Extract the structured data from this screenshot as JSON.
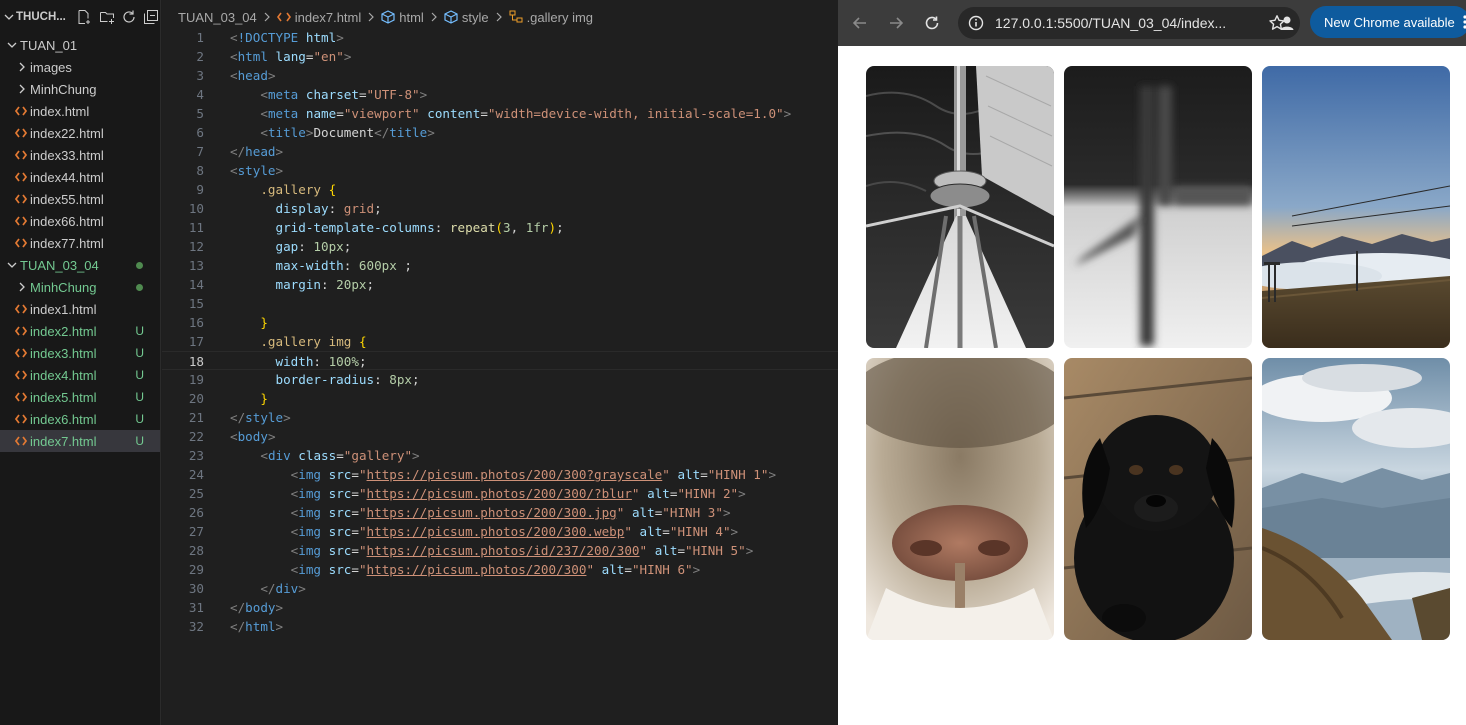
{
  "explorer": {
    "title": "THUCH...",
    "items": [
      {
        "label": "TUAN_01",
        "kind": "folder-open",
        "indent": 0,
        "color": "normal"
      },
      {
        "label": "images",
        "kind": "folder",
        "indent": 1,
        "color": "normal"
      },
      {
        "label": "MinhChung",
        "kind": "folder",
        "indent": 1,
        "color": "normal"
      },
      {
        "label": "index.html",
        "kind": "file",
        "indent": 1,
        "color": "normal"
      },
      {
        "label": "index22.html",
        "kind": "file",
        "indent": 1,
        "color": "normal"
      },
      {
        "label": "index33.html",
        "kind": "file",
        "indent": 1,
        "color": "normal"
      },
      {
        "label": "index44.html",
        "kind": "file",
        "indent": 1,
        "color": "normal"
      },
      {
        "label": "index55.html",
        "kind": "file",
        "indent": 1,
        "color": "normal"
      },
      {
        "label": "index66.html",
        "kind": "file",
        "indent": 1,
        "color": "normal"
      },
      {
        "label": "index77.html",
        "kind": "file",
        "indent": 1,
        "color": "normal"
      },
      {
        "label": "TUAN_03_04",
        "kind": "folder-open",
        "indent": 0,
        "color": "green",
        "status": "dot"
      },
      {
        "label": "MinhChung",
        "kind": "folder",
        "indent": 1,
        "color": "green",
        "status": "dot"
      },
      {
        "label": "index1.html",
        "kind": "file",
        "indent": 1,
        "color": "normal"
      },
      {
        "label": "index2.html",
        "kind": "file",
        "indent": 1,
        "color": "green",
        "status": "U"
      },
      {
        "label": "index3.html",
        "kind": "file",
        "indent": 1,
        "color": "green",
        "status": "U"
      },
      {
        "label": "index4.html",
        "kind": "file",
        "indent": 1,
        "color": "green",
        "status": "U"
      },
      {
        "label": "index5.html",
        "kind": "file",
        "indent": 1,
        "color": "green",
        "status": "U"
      },
      {
        "label": "index6.html",
        "kind": "file",
        "indent": 1,
        "color": "green",
        "status": "U"
      },
      {
        "label": "index7.html",
        "kind": "file",
        "indent": 1,
        "color": "green",
        "status": "U",
        "selected": true
      }
    ]
  },
  "breadcrumb": {
    "folder": "TUAN_03_04",
    "file": "index7.html",
    "html": "html",
    "style": "style",
    "selector": ".gallery img"
  },
  "editor": {
    "current_line": 18,
    "lines": [
      [
        [
          "t-bracket",
          "<"
        ],
        [
          "t-tag",
          "!DOCTYPE"
        ],
        [
          "t-text",
          " "
        ],
        [
          "t-attr",
          "html"
        ],
        [
          "t-bracket",
          ">"
        ]
      ],
      [
        [
          "t-bracket",
          "<"
        ],
        [
          "t-tag",
          "html"
        ],
        [
          "t-text",
          " "
        ],
        [
          "t-attr",
          "lang"
        ],
        [
          "t-punct",
          "="
        ],
        [
          "t-str",
          "\"en\""
        ],
        [
          "t-bracket",
          ">"
        ]
      ],
      [
        [
          "t-bracket",
          "<"
        ],
        [
          "t-tag",
          "head"
        ],
        [
          "t-bracket",
          ">"
        ]
      ],
      [
        [
          "t-text",
          "    "
        ],
        [
          "t-bracket",
          "<"
        ],
        [
          "t-tag",
          "meta"
        ],
        [
          "t-text",
          " "
        ],
        [
          "t-attr",
          "charset"
        ],
        [
          "t-punct",
          "="
        ],
        [
          "t-str",
          "\"UTF-8\""
        ],
        [
          "t-bracket",
          ">"
        ]
      ],
      [
        [
          "t-text",
          "    "
        ],
        [
          "t-bracket",
          "<"
        ],
        [
          "t-tag",
          "meta"
        ],
        [
          "t-text",
          " "
        ],
        [
          "t-attr",
          "name"
        ],
        [
          "t-punct",
          "="
        ],
        [
          "t-str",
          "\"viewport\""
        ],
        [
          "t-text",
          " "
        ],
        [
          "t-attr",
          "content"
        ],
        [
          "t-punct",
          "="
        ],
        [
          "t-str",
          "\"width=device-width, initial-scale=1.0\""
        ],
        [
          "t-bracket",
          ">"
        ]
      ],
      [
        [
          "t-text",
          "    "
        ],
        [
          "t-bracket",
          "<"
        ],
        [
          "t-tag",
          "title"
        ],
        [
          "t-bracket",
          ">"
        ],
        [
          "t-text",
          "Document"
        ],
        [
          "t-bracket",
          "</"
        ],
        [
          "t-tag",
          "title"
        ],
        [
          "t-bracket",
          ">"
        ]
      ],
      [
        [
          "t-bracket",
          "</"
        ],
        [
          "t-tag",
          "head"
        ],
        [
          "t-bracket",
          ">"
        ]
      ],
      [
        [
          "t-bracket",
          "<"
        ],
        [
          "t-tag",
          "style"
        ],
        [
          "t-bracket",
          ">"
        ]
      ],
      [
        [
          "t-text",
          "    "
        ],
        [
          "t-sel",
          ".gallery"
        ],
        [
          "t-text",
          " "
        ],
        [
          "t-brace",
          "{"
        ]
      ],
      [
        [
          "t-text",
          "      "
        ],
        [
          "t-prop",
          "display"
        ],
        [
          "t-punct",
          ": "
        ],
        [
          "t-val",
          "grid"
        ],
        [
          "t-punct",
          ";"
        ]
      ],
      [
        [
          "t-text",
          "      "
        ],
        [
          "t-prop",
          "grid-template-columns"
        ],
        [
          "t-punct",
          ": "
        ],
        [
          "t-fn",
          "repeat"
        ],
        [
          "t-brace",
          "("
        ],
        [
          "t-num",
          "3"
        ],
        [
          "t-punct",
          ", "
        ],
        [
          "t-num",
          "1fr"
        ],
        [
          "t-brace",
          ")"
        ],
        [
          "t-punct",
          ";"
        ]
      ],
      [
        [
          "t-text",
          "      "
        ],
        [
          "t-prop",
          "gap"
        ],
        [
          "t-punct",
          ": "
        ],
        [
          "t-num",
          "10px"
        ],
        [
          "t-punct",
          ";"
        ]
      ],
      [
        [
          "t-text",
          "      "
        ],
        [
          "t-prop",
          "max-width"
        ],
        [
          "t-punct",
          ": "
        ],
        [
          "t-num",
          "600px"
        ],
        [
          "t-punct",
          " ;"
        ]
      ],
      [
        [
          "t-text",
          "      "
        ],
        [
          "t-prop",
          "margin"
        ],
        [
          "t-punct",
          ": "
        ],
        [
          "t-num",
          "20px"
        ],
        [
          "t-punct",
          ";"
        ]
      ],
      [
        [
          "t-text",
          ""
        ]
      ],
      [
        [
          "t-text",
          "    "
        ],
        [
          "t-brace",
          "}"
        ]
      ],
      [
        [
          "t-text",
          "    "
        ],
        [
          "t-sel",
          ".gallery"
        ],
        [
          "t-text",
          " "
        ],
        [
          "t-sel",
          "img"
        ],
        [
          "t-text",
          " "
        ],
        [
          "t-brace",
          "{"
        ]
      ],
      [
        [
          "t-text",
          "      "
        ],
        [
          "t-prop",
          "width"
        ],
        [
          "t-punct",
          ": "
        ],
        [
          "t-num",
          "100%"
        ],
        [
          "t-punct",
          ";"
        ]
      ],
      [
        [
          "t-text",
          "      "
        ],
        [
          "t-prop",
          "border-radius"
        ],
        [
          "t-punct",
          ": "
        ],
        [
          "t-num",
          "8px"
        ],
        [
          "t-punct",
          ";"
        ]
      ],
      [
        [
          "t-text",
          "    "
        ],
        [
          "t-brace",
          "}"
        ]
      ],
      [
        [
          "t-bracket",
          "</"
        ],
        [
          "t-tag",
          "style"
        ],
        [
          "t-bracket",
          ">"
        ]
      ],
      [
        [
          "t-bracket",
          "<"
        ],
        [
          "t-tag",
          "body"
        ],
        [
          "t-bracket",
          ">"
        ]
      ],
      [
        [
          "t-text",
          "    "
        ],
        [
          "t-bracket",
          "<"
        ],
        [
          "t-tag",
          "div"
        ],
        [
          "t-text",
          " "
        ],
        [
          "t-attr",
          "class"
        ],
        [
          "t-punct",
          "="
        ],
        [
          "t-str",
          "\"gallery\""
        ],
        [
          "t-bracket",
          ">"
        ]
      ],
      [
        [
          "t-text",
          "        "
        ],
        [
          "t-bracket",
          "<"
        ],
        [
          "t-tag",
          "img"
        ],
        [
          "t-text",
          " "
        ],
        [
          "t-attr",
          "src"
        ],
        [
          "t-punct",
          "="
        ],
        [
          "t-str",
          "\""
        ],
        [
          "t-url",
          "https://picsum.photos/200/300?grayscale"
        ],
        [
          "t-str",
          "\""
        ],
        [
          "t-text",
          " "
        ],
        [
          "t-attr",
          "alt"
        ],
        [
          "t-punct",
          "="
        ],
        [
          "t-str",
          "\"HINH 1\""
        ],
        [
          "t-bracket",
          ">"
        ]
      ],
      [
        [
          "t-text",
          "        "
        ],
        [
          "t-bracket",
          "<"
        ],
        [
          "t-tag",
          "img"
        ],
        [
          "t-text",
          " "
        ],
        [
          "t-attr",
          "src"
        ],
        [
          "t-punct",
          "="
        ],
        [
          "t-str",
          "\""
        ],
        [
          "t-url",
          "https://picsum.photos/200/300/?blur"
        ],
        [
          "t-str",
          "\""
        ],
        [
          "t-text",
          " "
        ],
        [
          "t-attr",
          "alt"
        ],
        [
          "t-punct",
          "="
        ],
        [
          "t-str",
          "\"HINH 2\""
        ],
        [
          "t-bracket",
          ">"
        ]
      ],
      [
        [
          "t-text",
          "        "
        ],
        [
          "t-bracket",
          "<"
        ],
        [
          "t-tag",
          "img"
        ],
        [
          "t-text",
          " "
        ],
        [
          "t-attr",
          "src"
        ],
        [
          "t-punct",
          "="
        ],
        [
          "t-str",
          "\""
        ],
        [
          "t-url",
          "https://picsum.photos/200/300.jpg"
        ],
        [
          "t-str",
          "\""
        ],
        [
          "t-text",
          " "
        ],
        [
          "t-attr",
          "alt"
        ],
        [
          "t-punct",
          "="
        ],
        [
          "t-str",
          "\"HINH 3\""
        ],
        [
          "t-bracket",
          ">"
        ]
      ],
      [
        [
          "t-text",
          "        "
        ],
        [
          "t-bracket",
          "<"
        ],
        [
          "t-tag",
          "img"
        ],
        [
          "t-text",
          " "
        ],
        [
          "t-attr",
          "src"
        ],
        [
          "t-punct",
          "="
        ],
        [
          "t-str",
          "\""
        ],
        [
          "t-url",
          "https://picsum.photos/200/300.webp"
        ],
        [
          "t-str",
          "\""
        ],
        [
          "t-text",
          " "
        ],
        [
          "t-attr",
          "alt"
        ],
        [
          "t-punct",
          "="
        ],
        [
          "t-str",
          "\"HINH 4\""
        ],
        [
          "t-bracket",
          ">"
        ]
      ],
      [
        [
          "t-text",
          "        "
        ],
        [
          "t-bracket",
          "<"
        ],
        [
          "t-tag",
          "img"
        ],
        [
          "t-text",
          " "
        ],
        [
          "t-attr",
          "src"
        ],
        [
          "t-punct",
          "="
        ],
        [
          "t-str",
          "\""
        ],
        [
          "t-url",
          "https://picsum.photos/id/237/200/300"
        ],
        [
          "t-str",
          "\""
        ],
        [
          "t-text",
          " "
        ],
        [
          "t-attr",
          "alt"
        ],
        [
          "t-punct",
          "="
        ],
        [
          "t-str",
          "\"HINH 5\""
        ],
        [
          "t-bracket",
          ">"
        ]
      ],
      [
        [
          "t-text",
          "        "
        ],
        [
          "t-bracket",
          "<"
        ],
        [
          "t-tag",
          "img"
        ],
        [
          "t-text",
          " "
        ],
        [
          "t-attr",
          "src"
        ],
        [
          "t-punct",
          "="
        ],
        [
          "t-str",
          "\""
        ],
        [
          "t-url",
          "https://picsum.photos/200/300"
        ],
        [
          "t-str",
          "\""
        ],
        [
          "t-text",
          " "
        ],
        [
          "t-attr",
          "alt"
        ],
        [
          "t-punct",
          "="
        ],
        [
          "t-str",
          "\"HINH 6\""
        ],
        [
          "t-bracket",
          ">"
        ]
      ],
      [
        [
          "t-text",
          "    "
        ],
        [
          "t-bracket",
          "</"
        ],
        [
          "t-tag",
          "div"
        ],
        [
          "t-bracket",
          ">"
        ]
      ],
      [
        [
          "t-bracket",
          "</"
        ],
        [
          "t-tag",
          "body"
        ],
        [
          "t-bracket",
          ">"
        ]
      ],
      [
        [
          "t-bracket",
          "</"
        ],
        [
          "t-tag",
          "html"
        ],
        [
          "t-bracket",
          ">"
        ]
      ]
    ]
  },
  "browser": {
    "url": "127.0.0.1:5500/TUAN_03_04/index...",
    "update_label": "New Chrome available",
    "gallery": [
      {
        "subject": "sailboat-mast-grayscale"
      },
      {
        "subject": "blurred-grayscale"
      },
      {
        "subject": "mountain-sunset-clouds"
      },
      {
        "subject": "animal-nose-closeup"
      },
      {
        "subject": "black-puppy"
      },
      {
        "subject": "mountain-lake-valley"
      }
    ]
  },
  "colors": {
    "sidebar_bg": "#181818",
    "editor_bg": "#1f1f1f",
    "git_untracked": "#73c991",
    "chrome_toolbar": "#3c3c3c",
    "update_pill": "#0e5b9e"
  }
}
